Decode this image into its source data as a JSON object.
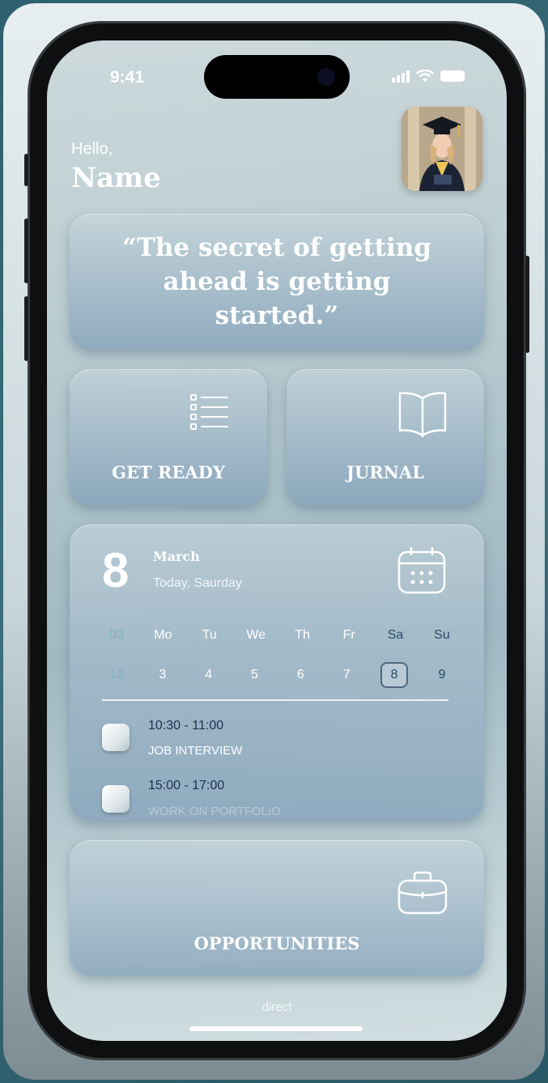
{
  "status_bar": {
    "time": "9:41"
  },
  "greeting": {
    "hello": "Hello,",
    "name": "Name"
  },
  "quote": {
    "text": "“The secret of getting ahead is getting started.”"
  },
  "tiles": [
    {
      "label": "GET READY",
      "icon": "checklist-icon"
    },
    {
      "label": "JURNAL",
      "icon": "book-icon"
    }
  ],
  "calendar": {
    "day": "8",
    "month": "March",
    "today_label": "Today, Saurday",
    "week_number": "03",
    "week_days": [
      "Mo",
      "Tu",
      "We",
      "Th",
      "Fr",
      "Sa",
      "Su"
    ],
    "week_label": "10",
    "dates": [
      "3",
      "4",
      "5",
      "6",
      "7",
      "8",
      "9"
    ],
    "selected_date": "8",
    "icon": "calendar-icon",
    "events": [
      {
        "time": "10:30 - 11:00",
        "title": "JOB INTERVIEW"
      },
      {
        "time": "15:00 - 17:00",
        "title": "WORK ON PORTFOLIO"
      }
    ]
  },
  "opportunities": {
    "label": "OPPORTUNITIES",
    "icon": "briefcase-icon"
  },
  "footer": {
    "label": "direct"
  },
  "colors": {
    "accent": "#2a4a68",
    "card": "#8ba6bd"
  }
}
